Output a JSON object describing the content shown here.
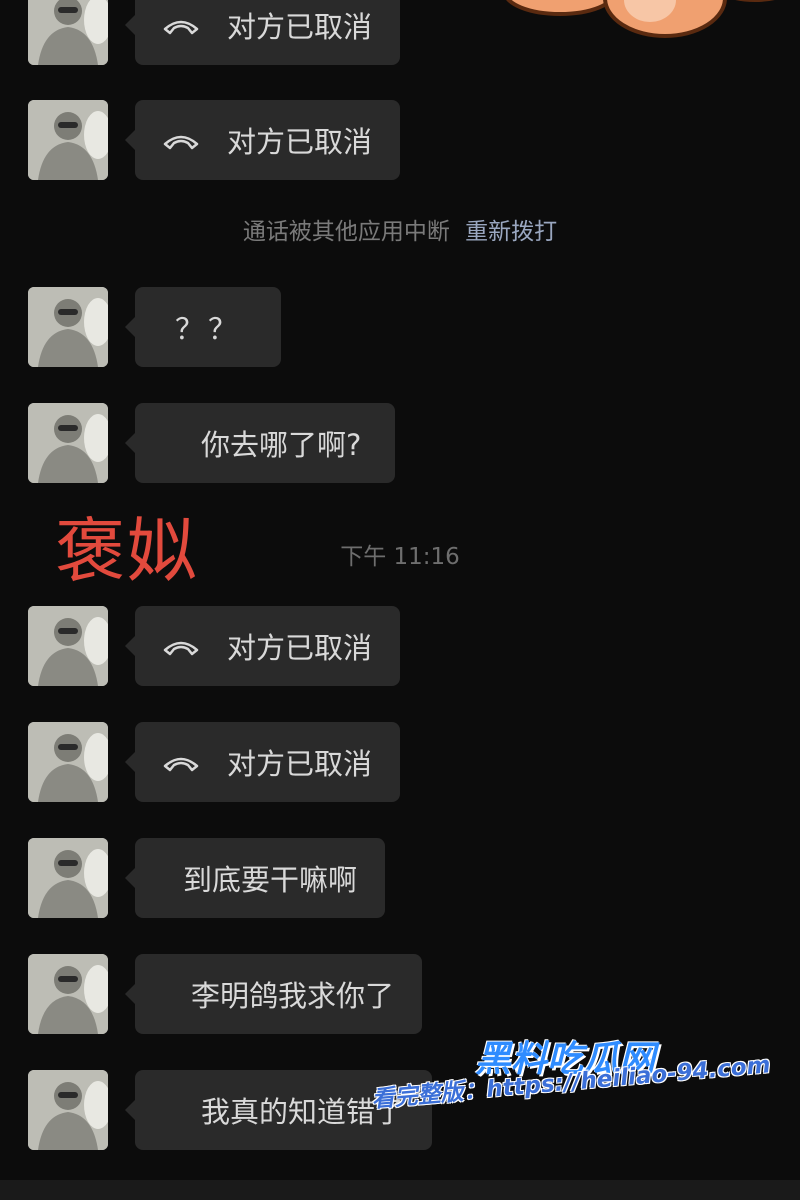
{
  "messages": [
    {
      "type": "call",
      "text": "对方已取消"
    },
    {
      "type": "call",
      "text": "对方已取消"
    },
    {
      "type": "text",
      "text": "？？"
    },
    {
      "type": "text",
      "text": "你去哪了啊?"
    },
    {
      "type": "call",
      "text": "对方已取消"
    },
    {
      "type": "call",
      "text": "对方已取消"
    },
    {
      "type": "text",
      "text": "到底要干嘛啊"
    },
    {
      "type": "text",
      "text": "李明鸽我求你了"
    },
    {
      "type": "text",
      "text": "我真的知道错了"
    }
  ],
  "system_note": {
    "text": "通话被其他应用中断",
    "action": "重新拨打"
  },
  "timestamp": "下午 11:16",
  "overlay_text": "褒姒",
  "watermark": {
    "title": "黑料吃瓜网",
    "url": "看完整版：https://heiliao-94.com"
  },
  "icons": {
    "call": "phone-hangup-icon",
    "avatar": "user-avatar-icon",
    "sticker": "cartoon-paw-sticker"
  },
  "colors": {
    "background": "#0c0c0c",
    "bubble": "#2a2a2a",
    "text": "#d9d9d9",
    "overlay": "#e24a3d",
    "watermark": "#2f8cff"
  }
}
